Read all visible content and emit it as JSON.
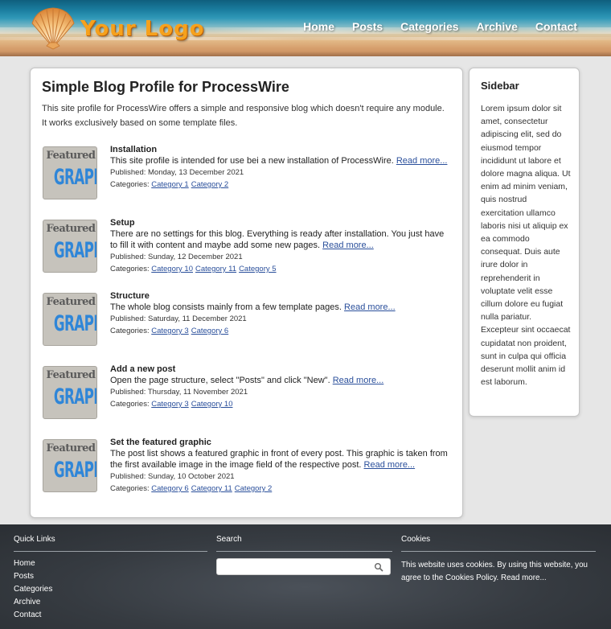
{
  "header": {
    "logo_text": "Your Logo",
    "nav": [
      "Home",
      "Posts",
      "Categories",
      "Archive",
      "Contact"
    ]
  },
  "main": {
    "title": "Simple Blog Profile for ProcessWire",
    "intro": "This site profile for ProcessWire offers a simple and responsive blog which doesn't require any module. It works exclusively based on some template files.",
    "thumb_line1": "Featured",
    "thumb_line2": "GRAPHIC",
    "read_more": "Read more...",
    "categories_label": "Categories:",
    "posts": [
      {
        "title": "Installation",
        "desc": "This site profile is intended for use bei a new installation of ProcessWire.",
        "published": "Published: Monday, 13 December 2021",
        "categories": [
          "Category 1",
          "Category 2"
        ]
      },
      {
        "title": "Setup",
        "desc": "There are no settings for this blog. Everything is ready after installation. You just have to fill it with content and maybe add some new pages.",
        "published": "Published: Sunday, 12 December 2021",
        "categories": [
          "Category 10",
          "Category 11",
          "Category 5"
        ]
      },
      {
        "title": "Structure",
        "desc": "The whole blog consists mainly from a few template pages.",
        "published": "Published: Saturday, 11 December 2021",
        "categories": [
          "Category 3",
          "Category 6"
        ]
      },
      {
        "title": "Add a new post",
        "desc": "Open the page structure, select \"Posts\" and click \"New\".",
        "published": "Published: Thursday, 11 November 2021",
        "categories": [
          "Category 3",
          "Category 10"
        ]
      },
      {
        "title": "Set the featured graphic",
        "desc": "The post list shows a featured graphic in front of every post. This graphic is taken from the first available image in the image field of the respective post.",
        "published": "Published: Sunday, 10 October 2021",
        "categories": [
          "Category 6",
          "Category 11",
          "Category 2"
        ]
      }
    ]
  },
  "sidebar": {
    "title": "Sidebar",
    "text": "Lorem ipsum dolor sit amet, consectetur adipiscing elit, sed do eiusmod tempor incididunt ut labore et dolore magna aliqua. Ut enim ad minim veniam, quis nostrud exercitation ullamco laboris nisi ut aliquip ex ea commodo consequat. Duis aute irure dolor in reprehenderit in voluptate velit esse cillum dolore eu fugiat nulla pariatur. Excepteur sint occaecat cupidatat non proident, sunt in culpa qui officia deserunt mollit anim id est laborum."
  },
  "footer": {
    "quick_links_title": "Quick Links",
    "quick_links": [
      "Home",
      "Posts",
      "Categories",
      "Archive",
      "Contact"
    ],
    "search_title": "Search",
    "search_value": "",
    "cookies_title": "Cookies",
    "cookies_text": "This website uses cookies. By using this website, you agree to the Cookies Policy.",
    "cookies_link": "Read more..."
  },
  "colors": {
    "accent_logo": "#f6a11c",
    "link": "#2a4f9b",
    "footer_bg": "#363b41",
    "thumb_blue": "#2f86d8"
  },
  "icons": {
    "logo": "scallop-shell-icon",
    "search": "magnifier-icon"
  }
}
